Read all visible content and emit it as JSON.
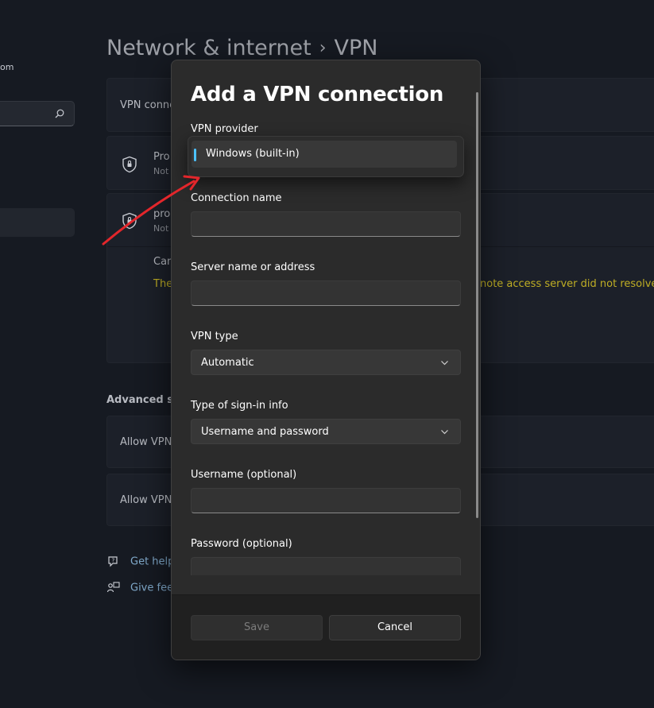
{
  "background": {
    "account_fragment": "om",
    "breadcrumb": {
      "parent": "Network & internet",
      "separator": "›",
      "current": "VPN"
    },
    "vpn_connections_label": "VPN conne",
    "profiles": [
      {
        "name": "Pro",
        "status": "Not"
      },
      {
        "name": "pro",
        "status": "Not"
      }
    ],
    "cancel_fragment": "Can",
    "error_left": "The",
    "error_right": "note access server did not resolve.",
    "advanced_heading": "Advanced set",
    "advanced_rows": [
      "Allow VPN",
      "Allow VPN"
    ],
    "links": {
      "get_help": "Get help",
      "give_feedback": "Give fee"
    }
  },
  "dialog": {
    "title": "Add a VPN connection",
    "vpn_provider": {
      "label": "VPN provider",
      "selected": "Windows (built-in)"
    },
    "connection_name": {
      "label": "Connection name",
      "value": ""
    },
    "server": {
      "label": "Server name or address",
      "value": ""
    },
    "vpn_type": {
      "label": "VPN type",
      "selected": "Automatic"
    },
    "signin_type": {
      "label": "Type of sign-in info",
      "selected": "Username and password"
    },
    "username": {
      "label": "Username (optional)",
      "value": ""
    },
    "password": {
      "label": "Password (optional)",
      "value": ""
    },
    "buttons": {
      "save": "Save",
      "cancel": "Cancel"
    }
  },
  "colors": {
    "accent": "#4cc2ff",
    "warning": "#bfae24",
    "annotation": "#e3262b",
    "link": "#7fa8c9"
  }
}
